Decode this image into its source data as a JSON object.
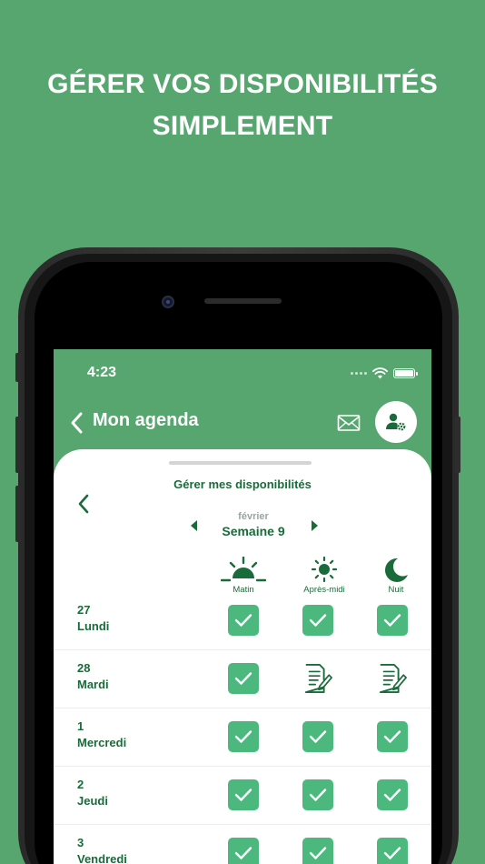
{
  "promo": {
    "line1": "GÉRER VOS DISPONIBILITÉS",
    "line2": "SIMPLEMENT"
  },
  "status_bar": {
    "time": "4:23"
  },
  "nav": {
    "title": "Mon agenda"
  },
  "sheet": {
    "title": "Gérer mes disponibilités",
    "month": "février",
    "week": "Semaine 9"
  },
  "columns": {
    "morning": "Matin",
    "afternoon": "Après-midi",
    "night": "Nuit"
  },
  "rows": [
    {
      "num": "27",
      "day": "Lundi",
      "morning": "check",
      "afternoon": "check",
      "night": "check"
    },
    {
      "num": "28",
      "day": "Mardi",
      "morning": "check",
      "afternoon": "edit",
      "night": "edit"
    },
    {
      "num": "1",
      "day": "Mercredi",
      "morning": "check",
      "afternoon": "check",
      "night": "check"
    },
    {
      "num": "2",
      "day": "Jeudi",
      "morning": "check",
      "afternoon": "check",
      "night": "check"
    },
    {
      "num": "3",
      "day": "Vendredi",
      "morning": "check",
      "afternoon": "check",
      "night": "check"
    }
  ],
  "colors": {
    "background": "#58a66f",
    "primary_text": "#1a6b3a",
    "check_fill": "#4cb87e"
  },
  "icons": {
    "back": "chevron-left-icon",
    "mail": "mail-icon",
    "profile_settings": "user-gear-icon",
    "morning": "sunrise-icon",
    "afternoon": "sun-icon",
    "night": "moon-icon",
    "available": "check-icon",
    "pending": "document-edit-icon"
  }
}
